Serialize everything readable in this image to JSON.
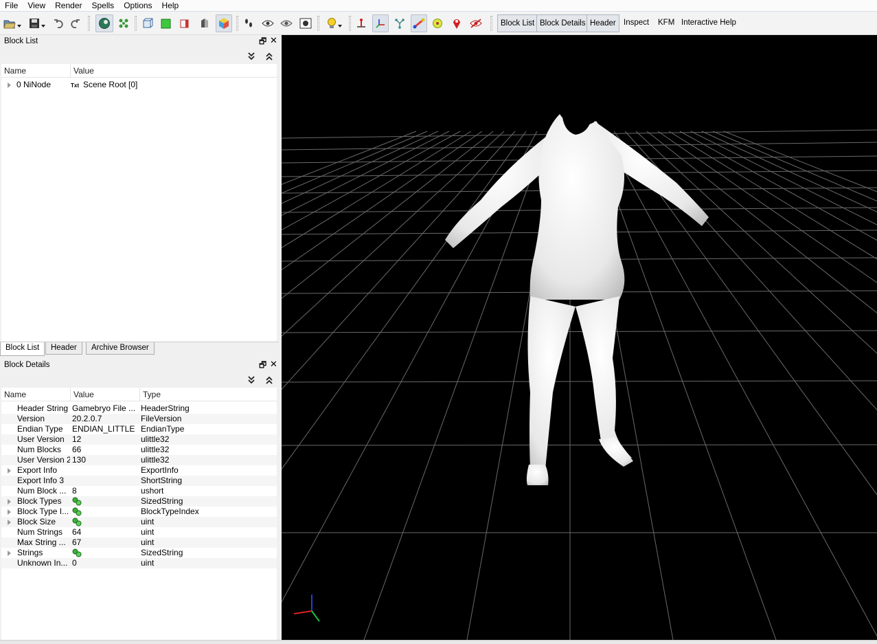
{
  "menu": [
    "File",
    "View",
    "Render",
    "Spells",
    "Options",
    "Help"
  ],
  "toolbar": {
    "text_buttons": [
      {
        "label": "Block List",
        "pressed": true
      },
      {
        "label": "Block Details",
        "pressed": true
      },
      {
        "label": "Header",
        "pressed": true
      },
      {
        "label": "Inspect",
        "pressed": false
      },
      {
        "label": "KFM",
        "pressed": false
      },
      {
        "label": "Interactive Help",
        "pressed": false
      }
    ]
  },
  "block_list": {
    "title": "Block List",
    "columns": {
      "name": "Name",
      "value": "Value"
    },
    "rows": [
      {
        "name": "0 NiNode",
        "value_tag": "Txt",
        "value": "Scene Root [0]"
      }
    ]
  },
  "tabs": [
    "Block List",
    "Header",
    "Archive Browser"
  ],
  "block_details": {
    "title": "Block Details",
    "columns": {
      "name": "Name",
      "value": "Value",
      "type": "Type"
    },
    "rows": [
      {
        "name": "Header String",
        "value": "Gamebryo File ...",
        "type": "HeaderString",
        "expandable": false,
        "icon": false
      },
      {
        "name": "Version",
        "value": "20.2.0.7",
        "type": "FileVersion",
        "expandable": false,
        "icon": false
      },
      {
        "name": "Endian Type",
        "value": "ENDIAN_LITTLE",
        "type": "EndianType",
        "expandable": false,
        "icon": false
      },
      {
        "name": "User Version",
        "value": "12",
        "type": "ulittle32",
        "expandable": false,
        "icon": false
      },
      {
        "name": "Num Blocks",
        "value": "66",
        "type": "ulittle32",
        "expandable": false,
        "icon": false
      },
      {
        "name": "User Version 2",
        "value": "130",
        "type": "ulittle32",
        "expandable": false,
        "icon": false
      },
      {
        "name": "Export Info",
        "value": "",
        "type": "ExportInfo",
        "expandable": true,
        "icon": false
      },
      {
        "name": "Export Info 3",
        "value": "",
        "type": "ShortString",
        "expandable": false,
        "icon": false
      },
      {
        "name": "Num Block ...",
        "value": "8",
        "type": "ushort",
        "expandable": false,
        "icon": false
      },
      {
        "name": "Block Types",
        "value": "",
        "type": "SizedString",
        "expandable": true,
        "icon": true
      },
      {
        "name": "Block Type I...",
        "value": "",
        "type": "BlockTypeIndex",
        "expandable": true,
        "icon": true
      },
      {
        "name": "Block Size",
        "value": "",
        "type": "uint",
        "expandable": true,
        "icon": true
      },
      {
        "name": "Num Strings",
        "value": "64",
        "type": "uint",
        "expandable": false,
        "icon": false
      },
      {
        "name": "Max String ...",
        "value": "67",
        "type": "uint",
        "expandable": false,
        "icon": false
      },
      {
        "name": "Strings",
        "value": "",
        "type": "SizedString",
        "expandable": true,
        "icon": true
      },
      {
        "name": "Unknown In...",
        "value": "0",
        "type": "uint",
        "expandable": false,
        "icon": false
      }
    ]
  },
  "colors": {
    "viewport_bg": "#000000",
    "grid": "#6a6a6a",
    "axis_x": "#e02020",
    "axis_y": "#20c040",
    "axis_z": "#2040e0",
    "model": "#f2f2f2"
  }
}
